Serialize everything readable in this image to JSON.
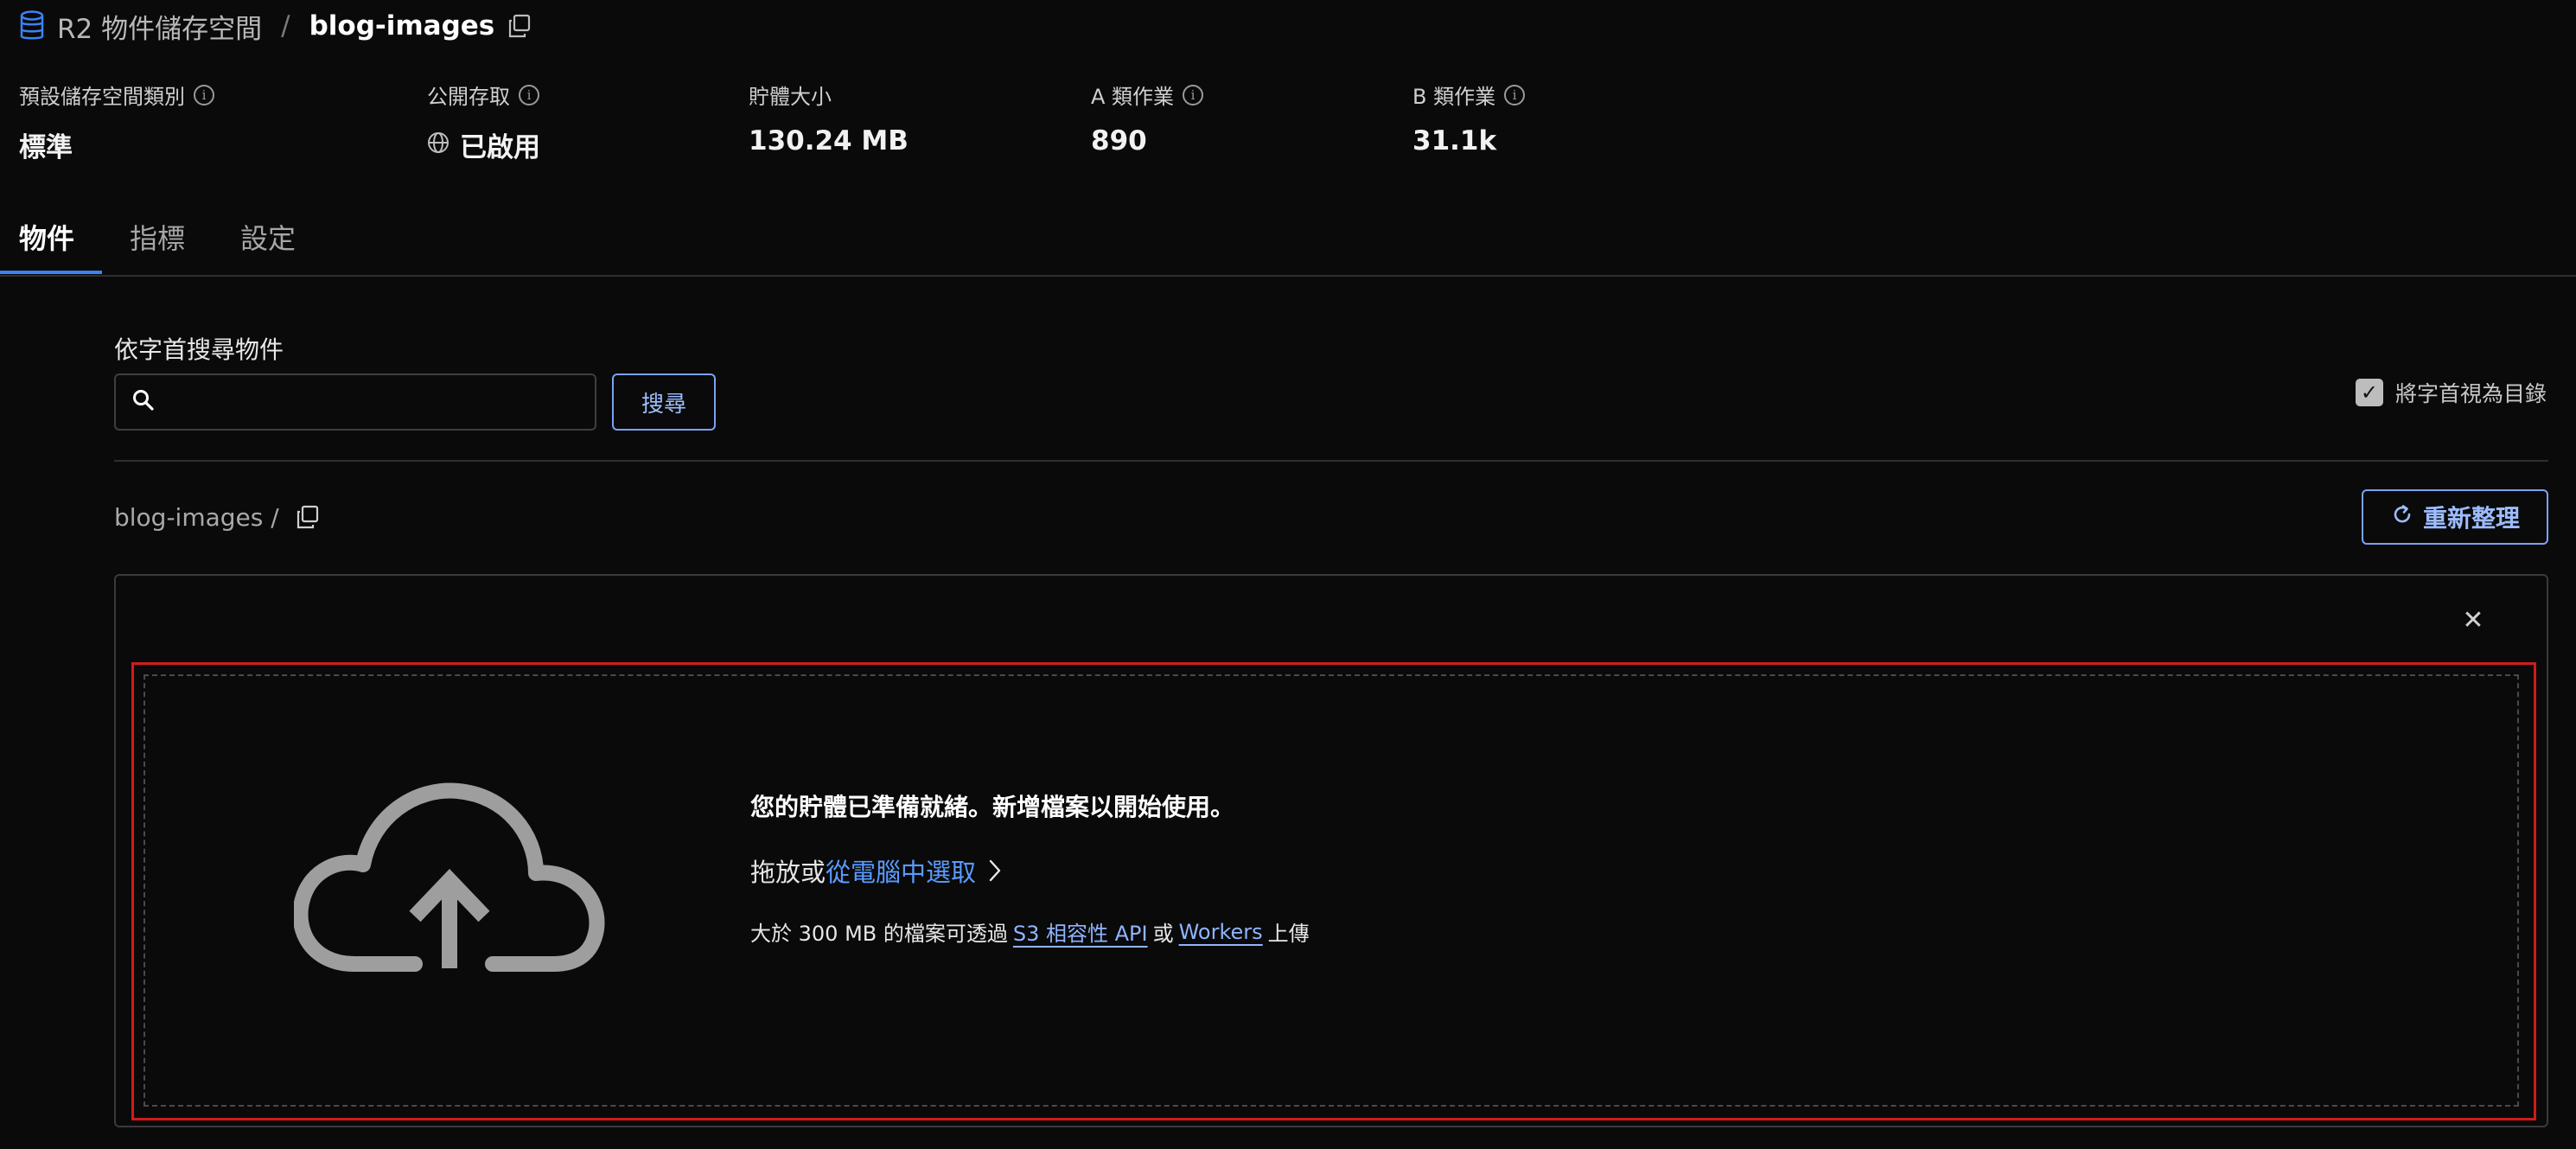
{
  "breadcrumb": {
    "service": "R2 物件儲存空間",
    "separator": "/",
    "bucket": "blog-images"
  },
  "stats": [
    {
      "label": "預設儲存空間類別",
      "value": "標準",
      "has_info": true
    },
    {
      "label": "公開存取",
      "value": "已啟用",
      "has_info": true,
      "icon": "globe-icon"
    },
    {
      "label": "貯體大小",
      "value": "130.24 MB",
      "has_info": false
    },
    {
      "label": "A 類作業",
      "value": "890",
      "has_info": true
    },
    {
      "label": "B 類作業",
      "value": "31.1k",
      "has_info": true
    }
  ],
  "tabs": [
    {
      "label": "物件",
      "active": true
    },
    {
      "label": "指標",
      "active": false
    },
    {
      "label": "設定",
      "active": false
    }
  ],
  "search": {
    "label": "依字首搜尋物件",
    "value": "",
    "button": "搜尋",
    "prefix_checkbox_label": "將字首視為目錄",
    "prefix_checked": true
  },
  "path": {
    "text": "blog-images /"
  },
  "refresh_button": "重新整理",
  "dropzone": {
    "title": "您的貯體已準備就緒。新增檔案以開始使用。",
    "drag_text": "拖放或",
    "select_link": "從電腦中選取",
    "note_prefix": "大於 300 MB 的檔案可透過",
    "s3_link": "S3 相容性 API",
    "note_or": "或",
    "workers_link": "Workers",
    "note_suffix": "上傳"
  },
  "colors": {
    "accent": "#3b82f6",
    "link": "#5a9bff",
    "highlight_border": "#d21b1b",
    "background": "#0a0a0a"
  }
}
